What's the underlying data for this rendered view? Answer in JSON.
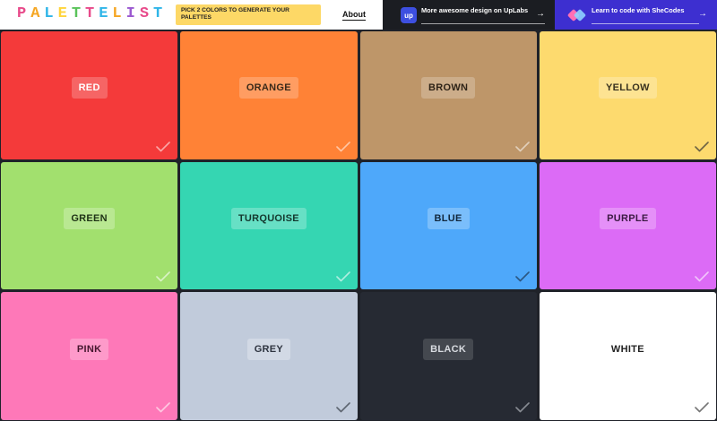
{
  "logo": {
    "letters": [
      {
        "ch": "P",
        "color": "#e84a8a"
      },
      {
        "ch": "A",
        "color": "#f5a623"
      },
      {
        "ch": "L",
        "color": "#2fb5e8"
      },
      {
        "ch": "E",
        "color": "#ffd43b"
      },
      {
        "ch": "T",
        "color": "#5ac35a"
      },
      {
        "ch": "T",
        "color": "#e84a8a"
      },
      {
        "ch": "E",
        "color": "#2fb5e8"
      },
      {
        "ch": "L",
        "color": "#f5a623"
      },
      {
        "ch": "I",
        "color": "#9b59d0"
      },
      {
        "ch": "S",
        "color": "#e84a8a"
      },
      {
        "ch": "T",
        "color": "#2fb5e8"
      }
    ]
  },
  "header": {
    "instruction": "PICK 2 COLORS TO GENERATE YOUR PALETTES",
    "about_label": "About",
    "uplabs": {
      "icon_text": "up",
      "text": "More awesome design on UpLabs",
      "arrow": "→"
    },
    "shecodes": {
      "text": "Learn to code with SheCodes",
      "arrow": "→"
    }
  },
  "colors": [
    {
      "id": "red",
      "label": "RED",
      "bg": "#f43a3a",
      "label_bg": "rgba(255,255,255,0.22)",
      "label_color": "#ffffff",
      "check_color": "#ffffff",
      "check_opacity": 0.55
    },
    {
      "id": "orange",
      "label": "ORANGE",
      "bg": "#ff8236",
      "label_bg": "rgba(255,255,255,0.22)",
      "label_color": "#3a2a1a",
      "check_color": "#ffffff",
      "check_opacity": 0.55
    },
    {
      "id": "brown",
      "label": "BROWN",
      "bg": "#be9669",
      "label_bg": "rgba(255,255,255,0.22)",
      "label_color": "#2f2418",
      "check_color": "#ffffff",
      "check_opacity": 0.55
    },
    {
      "id": "yellow",
      "label": "YELLOW",
      "bg": "#fdda6e",
      "label_bg": "rgba(255,255,255,0.25)",
      "label_color": "#3a3320",
      "check_color": "#333333",
      "check_opacity": 0.7
    },
    {
      "id": "green",
      "label": "GREEN",
      "bg": "#a2e06e",
      "label_bg": "rgba(255,255,255,0.25)",
      "label_color": "#1f3316",
      "check_color": "#ffffff",
      "check_opacity": 0.6
    },
    {
      "id": "turquoise",
      "label": "TURQUOISE",
      "bg": "#35d6b2",
      "label_bg": "rgba(255,255,255,0.25)",
      "label_color": "#14392f",
      "check_color": "#ffffff",
      "check_opacity": 0.6
    },
    {
      "id": "blue",
      "label": "BLUE",
      "bg": "#4ea8fa",
      "label_bg": "rgba(255,255,255,0.25)",
      "label_color": "#12283d",
      "check_color": "#1d3550",
      "check_opacity": 0.7
    },
    {
      "id": "purple",
      "label": "PURPLE",
      "bg": "#dc6bf6",
      "label_bg": "rgba(255,255,255,0.25)",
      "label_color": "#3b1a43",
      "check_color": "#ffffff",
      "check_opacity": 0.6
    },
    {
      "id": "pink",
      "label": "PINK",
      "bg": "#fe78b8",
      "label_bg": "rgba(255,255,255,0.25)",
      "label_color": "#45172e",
      "check_color": "#ffffff",
      "check_opacity": 0.6
    },
    {
      "id": "grey",
      "label": "GREY",
      "bg": "#c1cbdb",
      "label_bg": "rgba(255,255,255,0.28)",
      "label_color": "#2e3440",
      "check_color": "#333a44",
      "check_opacity": 0.7
    },
    {
      "id": "black",
      "label": "BLACK",
      "bg": "#262a33",
      "label_bg": "rgba(255,255,255,0.14)",
      "label_color": "#d8dbe0",
      "check_color": "#c8ccd2",
      "check_opacity": 0.6
    },
    {
      "id": "white",
      "label": "WHITE",
      "bg": "#ffffff",
      "label_bg": "rgba(0,0,0,0.0)",
      "label_color": "#222222",
      "check_color": "#555555",
      "check_opacity": 0.8
    }
  ]
}
